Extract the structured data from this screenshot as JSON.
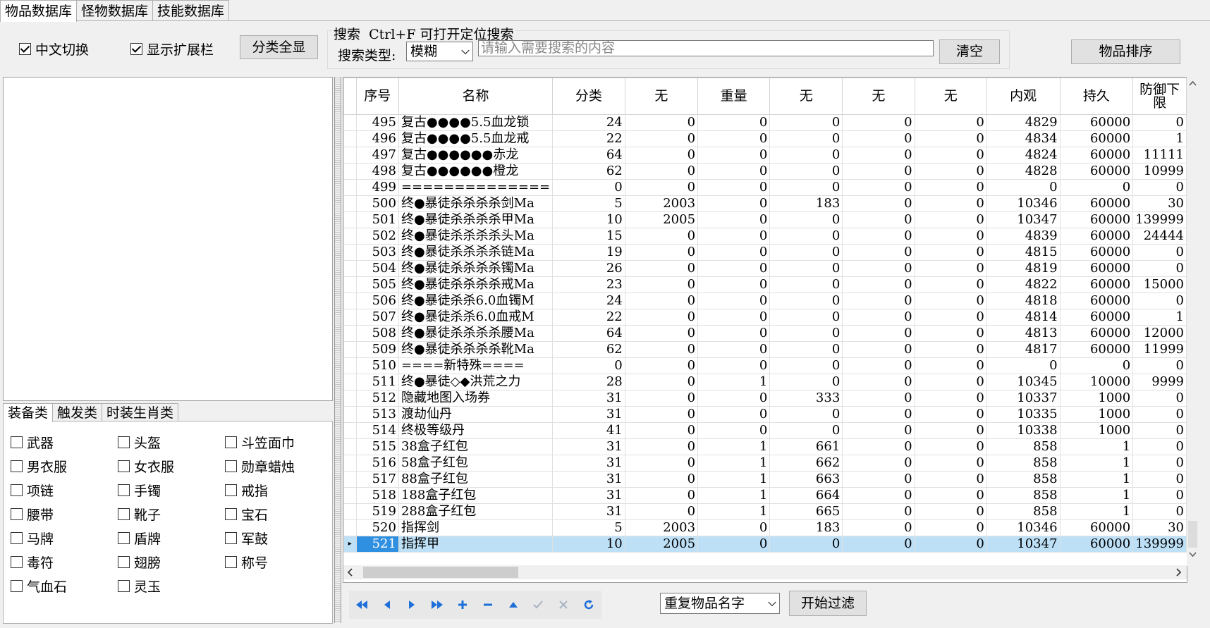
{
  "tabs": [
    "物品数据库",
    "怪物数据库",
    "技能数据库"
  ],
  "toolbar": {
    "cn_switch": "中文切换",
    "show_ext": "显示扩展栏",
    "show_all_btn": "分类全显",
    "search_title": "搜索  Ctrl+F 可打开定位搜索",
    "search_type_label": "搜索类型:",
    "search_type_value": "模糊",
    "search_placeholder": "请输入需要搜索的内容",
    "clear_btn": "清空",
    "sort_btn": "物品排序"
  },
  "left_tabs": [
    "装备类",
    "触发类",
    "时装生肖类"
  ],
  "categories": [
    "武器",
    "头盔",
    "斗笠面巾",
    "男衣服",
    "女衣服",
    "勋章蜡烛",
    "项链",
    "手镯",
    "戒指",
    "腰带",
    "靴子",
    "宝石",
    "马牌",
    "盾牌",
    "军鼓",
    "毒符",
    "翅膀",
    "称号",
    "气血石",
    "灵玉"
  ],
  "columns": [
    "序号",
    "名称",
    "分类",
    "无",
    "重量",
    "无",
    "无",
    "无",
    "内观",
    "持久",
    "防御下限"
  ],
  "rows": [
    [
      "495",
      "复古●●●●5.5血龙锁",
      "24",
      "0",
      "0",
      "0",
      "0",
      "0",
      "4829",
      "60000",
      "0"
    ],
    [
      "496",
      "复古●●●●5.5血龙戒",
      "22",
      "0",
      "0",
      "0",
      "0",
      "0",
      "4834",
      "60000",
      "1"
    ],
    [
      "497",
      "复古●●●●●●赤龙",
      "64",
      "0",
      "0",
      "0",
      "0",
      "0",
      "4824",
      "60000",
      "11111"
    ],
    [
      "498",
      "复古●●●●●●橙龙",
      "62",
      "0",
      "0",
      "0",
      "0",
      "0",
      "4828",
      "60000",
      "10999"
    ],
    [
      "499",
      "==============",
      "0",
      "0",
      "0",
      "0",
      "0",
      "0",
      "0",
      "0",
      "0"
    ],
    [
      "500",
      "终●暴徒杀杀杀杀剑Ma",
      "5",
      "2003",
      "0",
      "183",
      "0",
      "0",
      "10346",
      "60000",
      "30"
    ],
    [
      "501",
      "终●暴徒杀杀杀杀甲Ma",
      "10",
      "2005",
      "0",
      "0",
      "0",
      "0",
      "10347",
      "60000",
      "139999"
    ],
    [
      "502",
      "终●暴徒杀杀杀杀头Ma",
      "15",
      "0",
      "0",
      "0",
      "0",
      "0",
      "4839",
      "60000",
      "24444"
    ],
    [
      "503",
      "终●暴徒杀杀杀杀链Ma",
      "19",
      "0",
      "0",
      "0",
      "0",
      "0",
      "4815",
      "60000",
      "0"
    ],
    [
      "504",
      "终●暴徒杀杀杀杀镯Ma",
      "26",
      "0",
      "0",
      "0",
      "0",
      "0",
      "4819",
      "60000",
      "0"
    ],
    [
      "505",
      "终●暴徒杀杀杀杀戒Ma",
      "23",
      "0",
      "0",
      "0",
      "0",
      "0",
      "4822",
      "60000",
      "15000"
    ],
    [
      "506",
      "终●暴徒杀杀6.0血镯M",
      "24",
      "0",
      "0",
      "0",
      "0",
      "0",
      "4818",
      "60000",
      "0"
    ],
    [
      "507",
      "终●暴徒杀杀6.0血戒M",
      "22",
      "0",
      "0",
      "0",
      "0",
      "0",
      "4814",
      "60000",
      "1"
    ],
    [
      "508",
      "终●暴徒杀杀杀杀腰Ma",
      "64",
      "0",
      "0",
      "0",
      "0",
      "0",
      "4813",
      "60000",
      "12000"
    ],
    [
      "509",
      "终●暴徒杀杀杀杀靴Ma",
      "62",
      "0",
      "0",
      "0",
      "0",
      "0",
      "4817",
      "60000",
      "11999"
    ],
    [
      "510",
      "====新特殊====",
      "0",
      "0",
      "0",
      "0",
      "0",
      "0",
      "0",
      "0",
      "0"
    ],
    [
      "511",
      "终●暴徒◇◆洪荒之力",
      "28",
      "0",
      "1",
      "0",
      "0",
      "0",
      "10345",
      "10000",
      "9999"
    ],
    [
      "512",
      "隐藏地图入场券",
      "31",
      "0",
      "0",
      "333",
      "0",
      "0",
      "10337",
      "1000",
      "0"
    ],
    [
      "513",
      "渡劫仙丹",
      "31",
      "0",
      "0",
      "0",
      "0",
      "0",
      "10335",
      "1000",
      "0"
    ],
    [
      "514",
      "终极等级丹",
      "41",
      "0",
      "0",
      "0",
      "0",
      "0",
      "10338",
      "1000",
      "0"
    ],
    [
      "515",
      "38盒子红包",
      "31",
      "0",
      "1",
      "661",
      "0",
      "0",
      "858",
      "1",
      "0"
    ],
    [
      "516",
      "58盒子红包",
      "31",
      "0",
      "1",
      "662",
      "0",
      "0",
      "858",
      "1",
      "0"
    ],
    [
      "517",
      "88盒子红包",
      "31",
      "0",
      "1",
      "663",
      "0",
      "0",
      "858",
      "1",
      "0"
    ],
    [
      "518",
      "188盒子红包",
      "31",
      "0",
      "1",
      "664",
      "0",
      "0",
      "858",
      "1",
      "0"
    ],
    [
      "519",
      "288盒子红包",
      "31",
      "0",
      "1",
      "665",
      "0",
      "0",
      "858",
      "1",
      "0"
    ],
    [
      "520",
      "指挥剑",
      "5",
      "2003",
      "0",
      "183",
      "0",
      "0",
      "10346",
      "60000",
      "30"
    ],
    [
      "521",
      "指挥甲",
      "10",
      "2005",
      "0",
      "0",
      "0",
      "0",
      "10347",
      "60000",
      "139999"
    ]
  ],
  "selected_row": "521",
  "filter_value": "重复物品名字",
  "filter_btn": "开始过滤"
}
